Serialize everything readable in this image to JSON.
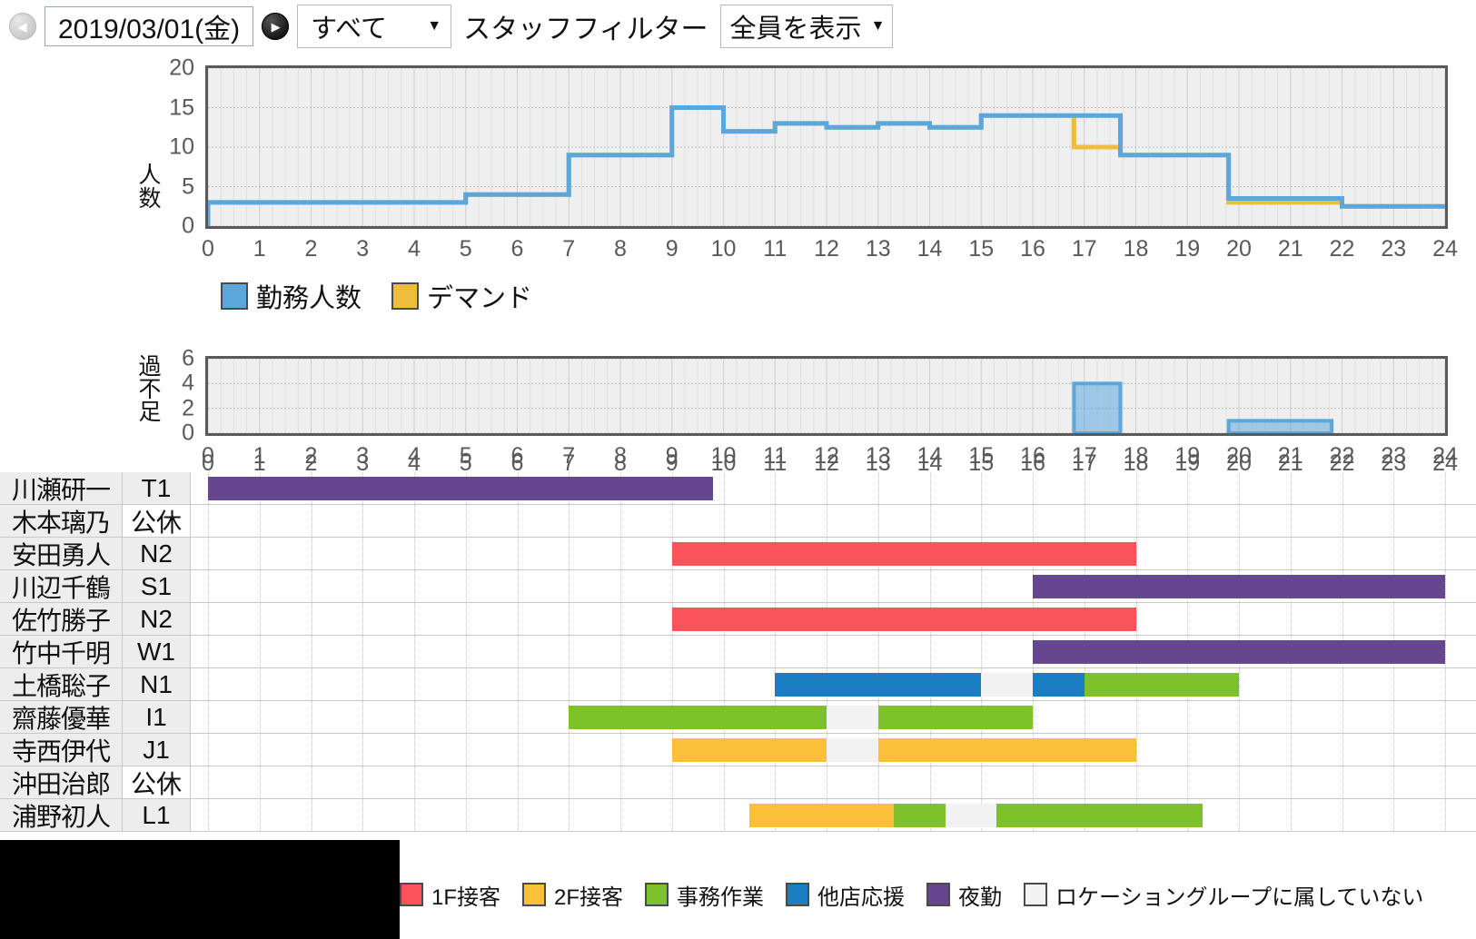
{
  "toolbar": {
    "prev_icon": "chevron-left-circle-icon",
    "next_icon": "chevron-right-circle-icon",
    "prev_glyph": "◀",
    "next_glyph": "▶",
    "date_value": "2019/03/01(金)",
    "scope_select": {
      "value": "すべて",
      "caret": "▼"
    },
    "filter_label": "スタッフフィルター",
    "staff_select": {
      "value": "全員を表示",
      "caret": "▼"
    }
  },
  "colors": {
    "staffing_blue": "#5BA7DC",
    "demand_yellow": "#EFBC3D",
    "task_1f": "#F9545A",
    "task_2f": "#FAC037",
    "task_office": "#7DC22B",
    "task_support": "#1B7EC2",
    "task_night": "#66468F",
    "task_none": "#EDEDED",
    "plot_bg": "#EFEFEF",
    "plot_border": "#595959"
  },
  "chart_data": [
    {
      "type": "line",
      "name": "staffing-vs-demand",
      "title": "",
      "ylabel": "人数",
      "xlabel": "",
      "xlim": [
        0,
        24
      ],
      "ylim": [
        0,
        20
      ],
      "yticks": [
        0,
        5,
        10,
        15,
        20
      ],
      "xticks": [
        0,
        1,
        2,
        3,
        4,
        5,
        6,
        7,
        8,
        9,
        10,
        11,
        12,
        13,
        14,
        15,
        16,
        17,
        18,
        19,
        20,
        21,
        22,
        23,
        24
      ],
      "grid": true,
      "step": "post",
      "legend": [
        {
          "label": "勤務人数",
          "color": "#5BA7DC"
        },
        {
          "label": "デマンド",
          "color": "#EFBC3D"
        }
      ],
      "series": [
        {
          "name": "勤務人数",
          "color": "#5BA7DC",
          "segments": [
            [
              0.0,
              5.0,
              3
            ],
            [
              5.0,
              7.0,
              4
            ],
            [
              7.0,
              9.0,
              9
            ],
            [
              9.0,
              10.0,
              15
            ],
            [
              10.0,
              11.0,
              12
            ],
            [
              11.0,
              12.0,
              13
            ],
            [
              12.0,
              13.0,
              12.5
            ],
            [
              13.0,
              14.0,
              13
            ],
            [
              14.0,
              15.0,
              12.5
            ],
            [
              15.0,
              17.7,
              14
            ],
            [
              17.7,
              19.8,
              9
            ],
            [
              19.8,
              22.0,
              3.5
            ],
            [
              22.0,
              24.0,
              2.5
            ]
          ]
        },
        {
          "name": "デマンド",
          "color": "#EFBC3D",
          "segments": [
            [
              0.0,
              5.0,
              3
            ],
            [
              5.0,
              7.0,
              4
            ],
            [
              7.0,
              9.0,
              9
            ],
            [
              9.0,
              10.0,
              15
            ],
            [
              10.0,
              11.0,
              12
            ],
            [
              11.0,
              12.0,
              13
            ],
            [
              12.0,
              13.0,
              12.5
            ],
            [
              13.0,
              14.0,
              13
            ],
            [
              14.0,
              15.0,
              12.5
            ],
            [
              15.0,
              16.8,
              14
            ],
            [
              16.8,
              17.7,
              10
            ],
            [
              17.7,
              19.8,
              9
            ],
            [
              19.8,
              22.0,
              3
            ],
            [
              22.0,
              24.0,
              2.5
            ]
          ]
        }
      ]
    },
    {
      "type": "bar",
      "name": "surplus-shortage",
      "title": "",
      "ylabel": "過不足",
      "xlabel": "",
      "xlim": [
        0,
        24
      ],
      "ylim": [
        0,
        6
      ],
      "yticks": [
        0,
        2,
        4,
        6
      ],
      "xticks": [
        0,
        1,
        2,
        3,
        4,
        5,
        6,
        7,
        8,
        9,
        10,
        11,
        12,
        13,
        14,
        15,
        16,
        17,
        18,
        19,
        20,
        21,
        22,
        23,
        24
      ],
      "grid": true,
      "color": "#5BA7DC",
      "bars": [
        {
          "start": 16.8,
          "end": 17.7,
          "value": 4
        },
        {
          "start": 19.8,
          "end": 21.8,
          "value": 1
        }
      ]
    }
  ],
  "gantt": {
    "xticks": [
      0,
      1,
      2,
      3,
      4,
      5,
      6,
      7,
      8,
      9,
      10,
      11,
      12,
      13,
      14,
      15,
      16,
      17,
      18,
      19,
      20,
      21,
      22,
      23,
      24
    ],
    "xlim": [
      0,
      24
    ],
    "rows": [
      {
        "name": "川瀬研一",
        "code": "T1",
        "off": false,
        "bars": [
          {
            "start": 0.0,
            "end": 9.8,
            "type": "night"
          }
        ]
      },
      {
        "name": "木本璃乃",
        "code": "公休",
        "off": true,
        "bars": []
      },
      {
        "name": "安田勇人",
        "code": "N2",
        "off": false,
        "bars": [
          {
            "start": 9.0,
            "end": 18.0,
            "type": "floor1"
          }
        ]
      },
      {
        "name": "川辺千鶴",
        "code": "S1",
        "off": false,
        "bars": [
          {
            "start": 16.0,
            "end": 24.0,
            "type": "night"
          }
        ]
      },
      {
        "name": "佐竹勝子",
        "code": "N2",
        "off": false,
        "bars": [
          {
            "start": 9.0,
            "end": 18.0,
            "type": "floor1"
          }
        ]
      },
      {
        "name": "竹中千明",
        "code": "W1",
        "off": false,
        "bars": [
          {
            "start": 16.0,
            "end": 24.0,
            "type": "night"
          }
        ]
      },
      {
        "name": "土橋聡子",
        "code": "N1",
        "off": false,
        "bars": [
          {
            "start": 11.0,
            "end": 15.0,
            "type": "support"
          },
          {
            "start": 15.0,
            "end": 16.0,
            "type": "none"
          },
          {
            "start": 16.0,
            "end": 17.0,
            "type": "support"
          },
          {
            "start": 17.0,
            "end": 20.0,
            "type": "office"
          }
        ]
      },
      {
        "name": "齋藤優華",
        "code": "I1",
        "off": false,
        "bars": [
          {
            "start": 7.0,
            "end": 12.0,
            "type": "office"
          },
          {
            "start": 12.0,
            "end": 13.0,
            "type": "none"
          },
          {
            "start": 13.0,
            "end": 16.0,
            "type": "office"
          }
        ]
      },
      {
        "name": "寺西伊代",
        "code": "J1",
        "off": false,
        "bars": [
          {
            "start": 9.0,
            "end": 12.0,
            "type": "floor2"
          },
          {
            "start": 12.0,
            "end": 13.0,
            "type": "none"
          },
          {
            "start": 13.0,
            "end": 18.0,
            "type": "floor2"
          }
        ]
      },
      {
        "name": "沖田治郎",
        "code": "公休",
        "off": true,
        "bars": []
      },
      {
        "name": "浦野初人",
        "code": "L1",
        "off": false,
        "bars": [
          {
            "start": 10.5,
            "end": 13.3,
            "type": "floor2"
          },
          {
            "start": 13.3,
            "end": 14.3,
            "type": "office"
          },
          {
            "start": 14.3,
            "end": 15.3,
            "type": "none"
          },
          {
            "start": 15.3,
            "end": 19.3,
            "type": "office"
          }
        ]
      }
    ]
  },
  "bottom_legend": [
    {
      "label": "1F接客",
      "color": "#F9545A",
      "key": "floor1"
    },
    {
      "label": "2F接客",
      "color": "#FAC037",
      "key": "floor2"
    },
    {
      "label": "事務作業",
      "color": "#7DC22B",
      "key": "office"
    },
    {
      "label": "他店応援",
      "color": "#1B7EC2",
      "key": "support"
    },
    {
      "label": "夜勤",
      "color": "#66468F",
      "key": "night"
    },
    {
      "label": "ロケーショングループに属していない",
      "color": "#F2F2F2",
      "key": "none"
    }
  ]
}
